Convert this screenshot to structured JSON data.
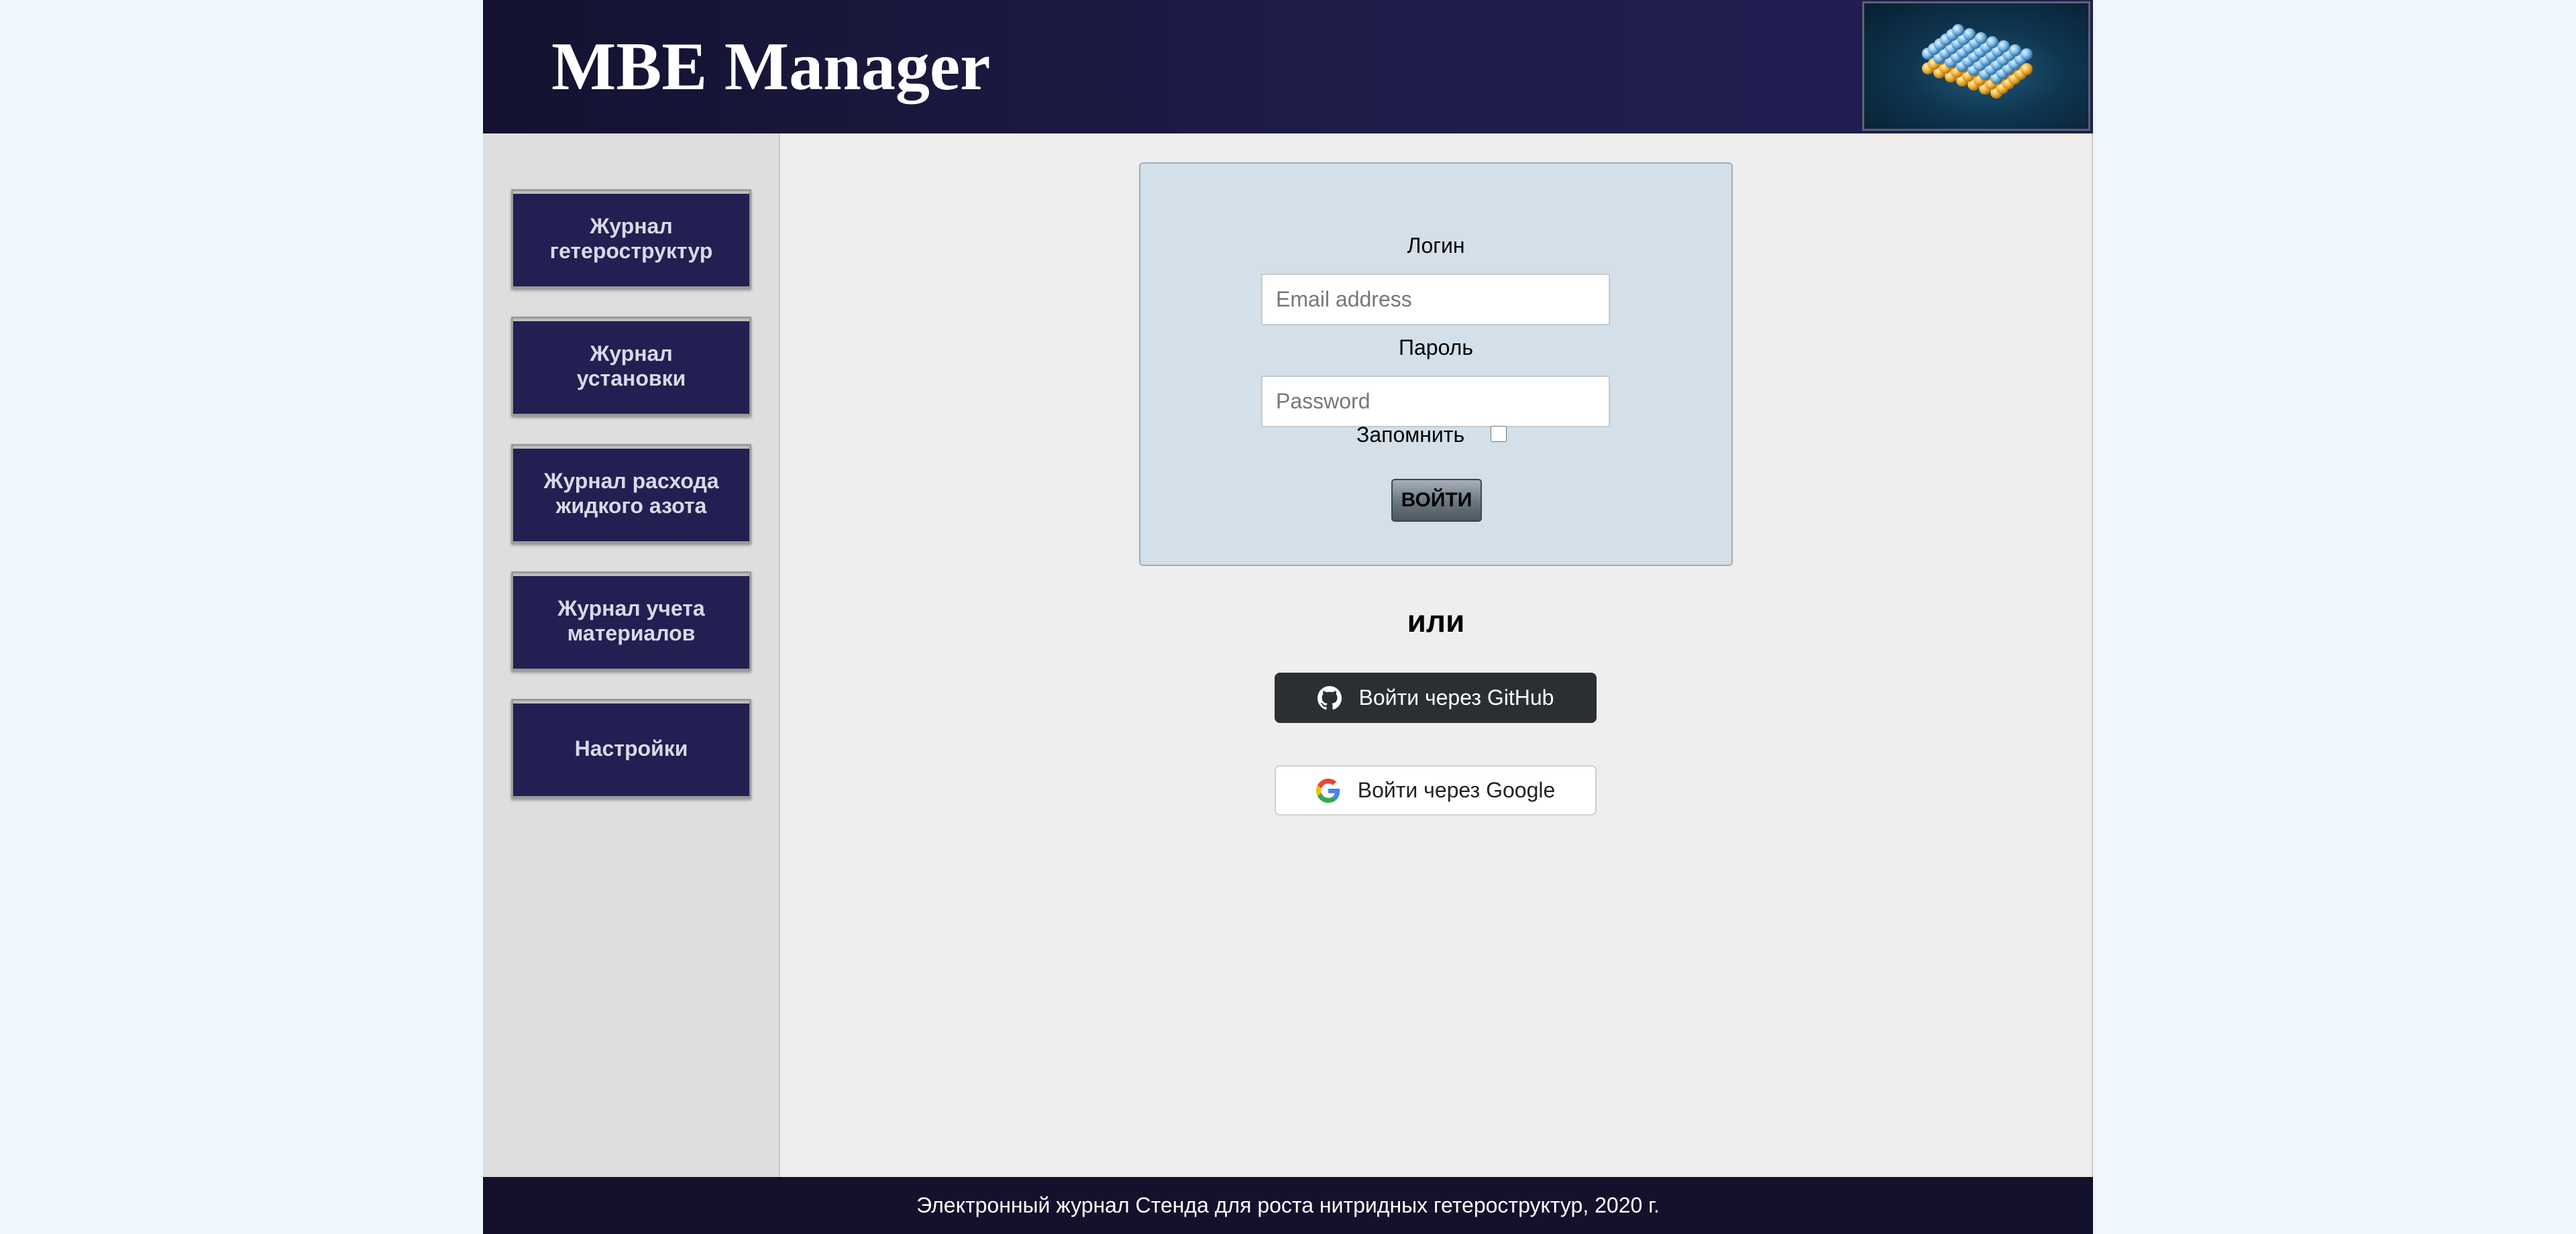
{
  "header": {
    "title": "MBE Manager",
    "logo_icon": "crystal-lattice-icon"
  },
  "sidebar": {
    "items": [
      {
        "label": "Журнал гетероструктур"
      },
      {
        "label": "Журнал установки"
      },
      {
        "label": "Журнал расхода жидкого азота"
      },
      {
        "label": "Журнал учета материалов"
      },
      {
        "label": "Настройки"
      }
    ]
  },
  "login": {
    "login_label": "Логин",
    "email_placeholder": "Email address",
    "email_value": "",
    "password_label": "Пароль",
    "password_placeholder": "Password",
    "password_value": "",
    "remember_label": "Запомнить",
    "remember_checked": false,
    "submit_label": "ВОЙТИ"
  },
  "or_text": "или",
  "oauth": {
    "github": {
      "label": "Войти через GitHub",
      "icon": "github-icon"
    },
    "google": {
      "label": "Войти через Google",
      "icon": "google-icon"
    }
  },
  "footer": {
    "text": "Электронный журнал Стенда для роста нитридных гетероструктур, 2020 г."
  },
  "colors": {
    "header_bg": "#1e1c48",
    "sidebar_button_bg": "#221f52",
    "login_panel_bg": "#d3dfe9",
    "github_button_bg": "#2b2f33",
    "footer_bg": "#13112b"
  }
}
